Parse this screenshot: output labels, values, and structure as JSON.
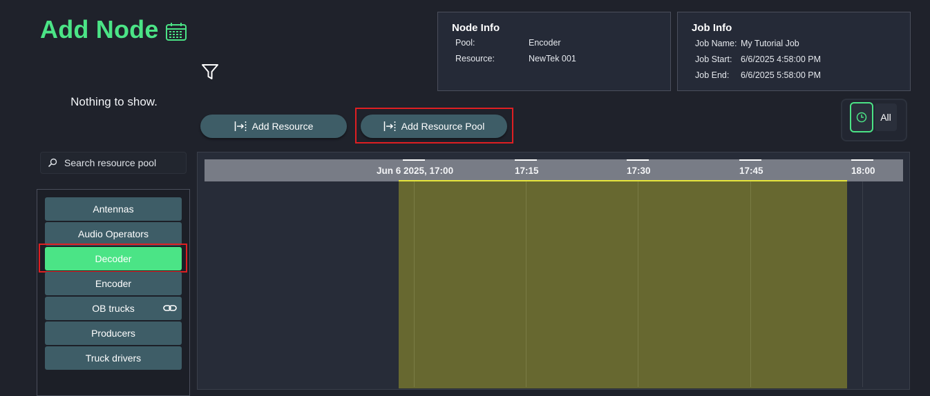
{
  "page": {
    "title": "Add Node",
    "empty_message": "Nothing to show."
  },
  "icons": {
    "calendar": "calendar-icon",
    "filter": "filter-icon",
    "add": "arrow-to-bar-icon",
    "search": "search-icon",
    "link": "link-icon",
    "clock": "clock-icon"
  },
  "colors": {
    "accent": "#4be486",
    "button": "#3e5d67",
    "job_block": "#676830",
    "job_line": "#e6e63a",
    "highlight": "#e01f22"
  },
  "node_info": {
    "heading": "Node Info",
    "rows": [
      {
        "key": "Pool:",
        "value": "Encoder"
      },
      {
        "key": "Resource:",
        "value": "NewTek 001"
      }
    ]
  },
  "job_info": {
    "heading": "Job Info",
    "rows": [
      {
        "key": "Job Name:",
        "value": "My Tutorial Job"
      },
      {
        "key": "Job Start:",
        "value": "6/6/2025 4:58:00 PM"
      },
      {
        "key": "Job End:",
        "value": "6/6/2025 5:58:00 PM"
      }
    ]
  },
  "actions": {
    "add_resource": "Add Resource",
    "add_resource_pool": "Add Resource Pool"
  },
  "view_toggle": {
    "all_label": "All",
    "selected": "clock"
  },
  "search": {
    "placeholder": "Search resource pool",
    "value": ""
  },
  "pools": {
    "selected": "Decoder",
    "items": [
      {
        "label": "Antennas"
      },
      {
        "label": "Audio Operators"
      },
      {
        "label": "Decoder"
      },
      {
        "label": "Encoder"
      },
      {
        "label": "OB trucks"
      },
      {
        "label": "Producers"
      },
      {
        "label": "Truck drivers"
      }
    ]
  },
  "timeline": {
    "ticks": [
      "Jun 6 2025, 17:00",
      "17:15",
      "17:30",
      "17:45",
      "18:00"
    ],
    "job_start": "16:58",
    "job_end": "17:58"
  }
}
